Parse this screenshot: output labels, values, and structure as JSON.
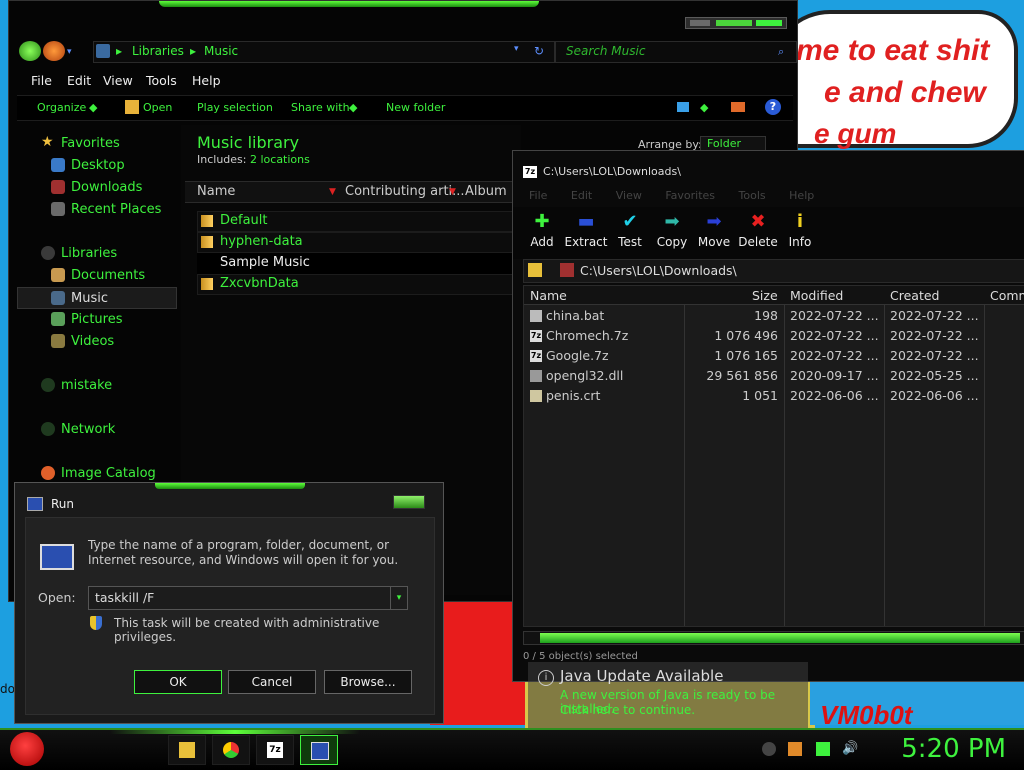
{
  "desktop": {
    "bubble_lines": [
      "me to eat shit",
      "e and chew",
      "e gum"
    ],
    "watermark_text": "VM0b0t",
    "icon_label_fragment": "do",
    "colors": {
      "desktop_blue": "#1d9fe0",
      "accent_green": "#3ef23e",
      "bubble_text": "#e02020"
    }
  },
  "explorer": {
    "address": {
      "root_icon": "libraries-icon",
      "crumbs": [
        "Libraries",
        "Music"
      ]
    },
    "search_placeholder": "Search Music",
    "menu": [
      "File",
      "Edit",
      "View",
      "Tools",
      "Help"
    ],
    "commands": [
      "Organize",
      "Open",
      "Play selection",
      "Share with",
      "New folder"
    ],
    "help_glyph": "?",
    "nav": {
      "favorites_label": "Favorites",
      "favorites": [
        "Desktop",
        "Downloads",
        "Recent Places"
      ],
      "libraries_label": "Libraries",
      "libraries": [
        "Documents",
        "Music",
        "Pictures",
        "Videos"
      ],
      "selected": "Music",
      "other": [
        "mistake",
        "Network",
        "Image Catalog"
      ]
    },
    "library": {
      "title": "Music library",
      "includes_prefix": "Includes:",
      "includes_link": "2 locations",
      "arrange_by_label": "Arrange by:",
      "arrange_by_value": "Folder"
    },
    "columns": [
      "Name",
      "Contributing arti...",
      "Album"
    ],
    "files": [
      {
        "name": "Default",
        "highlight": true
      },
      {
        "name": "hyphen-data",
        "highlight": true
      },
      {
        "name": "Sample Music",
        "highlight": false
      },
      {
        "name": "ZxcvbnData",
        "highlight": true
      }
    ]
  },
  "sevenzip": {
    "title": "C:\\Users\\LOL\\Downloads\\",
    "title_icon": "7z",
    "menu": [
      "File",
      "Edit",
      "View",
      "Favorites",
      "Tools",
      "Help"
    ],
    "toolbar": [
      {
        "label": "Add",
        "icon": "plus-icon",
        "glyph": "✚",
        "color": "#3ef23e"
      },
      {
        "label": "Extract",
        "icon": "minus-icon",
        "glyph": "▬",
        "color": "#2a4fd6"
      },
      {
        "label": "Test",
        "icon": "test-icon",
        "glyph": "✔",
        "color": "#1fd0e8"
      },
      {
        "label": "Copy",
        "icon": "copy-icon",
        "glyph": "➡",
        "color": "#2fb8a8"
      },
      {
        "label": "Move",
        "icon": "move-icon",
        "glyph": "➡",
        "color": "#2a3fd6"
      },
      {
        "label": "Delete",
        "icon": "delete-icon",
        "glyph": "✖",
        "color": "#e82020"
      },
      {
        "label": "Info",
        "icon": "info-icon",
        "glyph": "i",
        "color": "#f0d020"
      }
    ],
    "path": "C:\\Users\\LOL\\Downloads\\",
    "columns": [
      "Name",
      "Size",
      "Modified",
      "Created",
      "Comm"
    ],
    "rows": [
      {
        "name": "china.bat",
        "size": "198",
        "modified": "2022-07-22 ...",
        "created": "2022-07-22 ...",
        "icon": "bat"
      },
      {
        "name": "Chromech.7z",
        "size": "1 076 496",
        "modified": "2022-07-22 ...",
        "created": "2022-07-22 ...",
        "icon": "7z"
      },
      {
        "name": "Google.7z",
        "size": "1 076 165",
        "modified": "2022-07-22 ...",
        "created": "2022-07-22 ...",
        "icon": "7z"
      },
      {
        "name": "opengl32.dll",
        "size": "29 561 856",
        "modified": "2020-09-17 ...",
        "created": "2022-05-25 ...",
        "icon": "dll"
      },
      {
        "name": "penis.crt",
        "size": "1 051",
        "modified": "2022-06-06 ...",
        "created": "2022-06-06 ...",
        "icon": "crt"
      }
    ],
    "status": "0 / 5 object(s) selected"
  },
  "java_notice": {
    "title": "Java Update Available",
    "line1": "A new version of Java is ready to be installed.",
    "line2": "Click here to continue.",
    "icon_glyph": "i"
  },
  "run_dialog": {
    "title": "Run",
    "description": "Type the name of a program, folder, document, or Internet resource, and Windows will open it for you.",
    "open_label": "Open:",
    "input_value": "taskkill /F",
    "admin_note": "This task will be created with administrative privileges.",
    "buttons": {
      "ok": "OK",
      "cancel": "Cancel",
      "browse": "Browse..."
    },
    "dropdown_glyph": "▾"
  },
  "taskbar": {
    "clock": "5:20 PM",
    "pinned": [
      "explorer-icon",
      "chrome-icon",
      "7zip-icon",
      "run-icon"
    ],
    "pinned_7z_glyph": "7z"
  }
}
